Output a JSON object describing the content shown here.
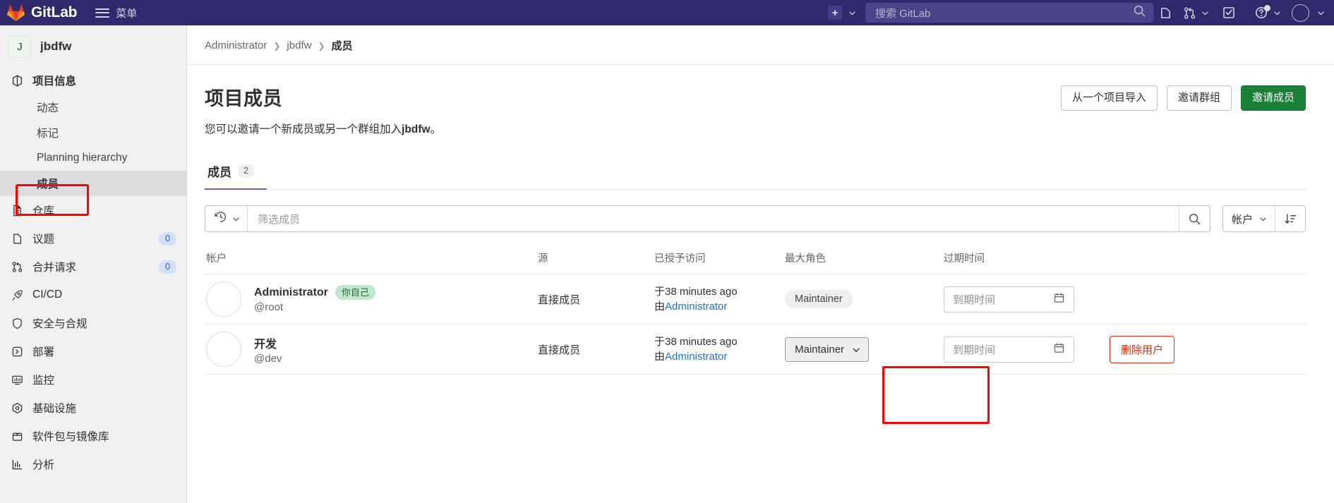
{
  "navbar": {
    "brand": "GitLab",
    "menu_label": "菜单",
    "plus_icon": "plus-icon",
    "search_placeholder": "搜索 GitLab",
    "icons": [
      {
        "name": "issues-icon",
        "glyph": "issues"
      },
      {
        "name": "merge-requests-icon",
        "glyph": "merge"
      },
      {
        "name": "todos-icon",
        "glyph": "todo"
      },
      {
        "name": "help-icon",
        "glyph": "help"
      },
      {
        "name": "user-avatar",
        "glyph": "avatar"
      }
    ]
  },
  "sidebar": {
    "project": {
      "initial": "J",
      "name": "jbdfw"
    },
    "items": [
      {
        "label": "项目信息",
        "icon": "project-info-icon",
        "level": "top",
        "badge": null,
        "active": false
      },
      {
        "label": "动态",
        "icon": null,
        "level": "sub",
        "badge": null,
        "active": false
      },
      {
        "label": "标记",
        "icon": null,
        "level": "sub",
        "badge": null,
        "active": false
      },
      {
        "label": "Planning hierarchy",
        "icon": null,
        "level": "sub",
        "badge": null,
        "active": false
      },
      {
        "label": "成员",
        "icon": null,
        "level": "sub",
        "badge": null,
        "active": true
      },
      {
        "label": "仓库",
        "icon": "repository-icon",
        "level": "top",
        "badge": null,
        "active": false
      },
      {
        "label": "议题",
        "icon": "issues-icon",
        "level": "top",
        "badge": "0",
        "active": false
      },
      {
        "label": "合并请求",
        "icon": "merge-request-icon",
        "level": "top",
        "badge": "0",
        "active": false
      },
      {
        "label": "CI/CD",
        "icon": "rocket-icon",
        "level": "top",
        "badge": null,
        "active": false
      },
      {
        "label": "安全与合规",
        "icon": "shield-icon",
        "level": "top",
        "badge": null,
        "active": false
      },
      {
        "label": "部署",
        "icon": "deploy-icon",
        "level": "top",
        "badge": null,
        "active": false
      },
      {
        "label": "监控",
        "icon": "monitor-icon",
        "level": "top",
        "badge": null,
        "active": false
      },
      {
        "label": "基础设施",
        "icon": "infrastructure-icon",
        "level": "top",
        "badge": null,
        "active": false
      },
      {
        "label": "软件包与镜像库",
        "icon": "package-icon",
        "level": "top",
        "badge": null,
        "active": false
      },
      {
        "label": "分析",
        "icon": "analytics-icon",
        "level": "top",
        "badge": null,
        "active": false
      }
    ]
  },
  "breadcrumb": [
    {
      "label": "Administrator",
      "current": false
    },
    {
      "label": "jbdfw",
      "current": false
    },
    {
      "label": "成员",
      "current": true
    }
  ],
  "page": {
    "title": "项目成员",
    "subtitle_pre": "您可以邀请一个新成员或另一个群组加入",
    "subtitle_bold": "jbdfw",
    "subtitle_post": "。",
    "actions": [
      {
        "label": "从一个项目导入",
        "style": "default"
      },
      {
        "label": "邀请群组",
        "style": "default"
      },
      {
        "label": "邀请成员",
        "style": "primary"
      }
    ]
  },
  "tabs": [
    {
      "label": "成员",
      "count": "2",
      "active": true
    }
  ],
  "filter": {
    "history_icon": "history-icon",
    "placeholder": "筛选成员",
    "search_icon": "search-icon",
    "sort_field": "帐户",
    "sort_direction_icon": "sort-descending-icon"
  },
  "table": {
    "headers": [
      "帐户",
      "源",
      "已授予访问",
      "最大角色",
      "过期时间",
      ""
    ],
    "rows": [
      {
        "name": "Administrator",
        "badge": "你自己",
        "handle": "@root",
        "source": "直接成员",
        "granted_time": "于38 minutes ago",
        "granted_by_prefix": "由",
        "granted_by": "Administrator",
        "role": "Maintainer",
        "role_type": "pill",
        "expires_placeholder": "到期时间",
        "remove_label": null
      },
      {
        "name": "开发",
        "badge": null,
        "handle": "@dev",
        "source": "直接成员",
        "granted_time": "于38 minutes ago",
        "granted_by_prefix": "由",
        "granted_by": "Administrator",
        "role": "Maintainer",
        "role_type": "dropdown",
        "expires_placeholder": "到期时间",
        "remove_label": "删除用户"
      }
    ]
  },
  "colors": {
    "navbar_bg": "#2f2a6b",
    "primary_button": "#1a7f37",
    "link": "#1f75cb",
    "danger": "#dd2b0e",
    "highlight_box": "#fe0000",
    "tab_underline": "#6666c4"
  }
}
